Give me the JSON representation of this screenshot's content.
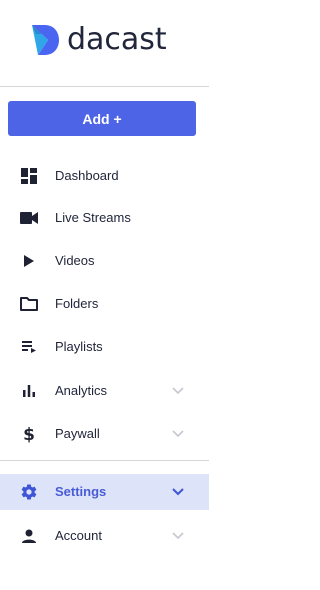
{
  "brand": {
    "name": "dacast",
    "accent": "#4d64e6",
    "logo_color": "#4a65f0"
  },
  "add_button": {
    "label": "Add +"
  },
  "nav": {
    "items": [
      {
        "label": "Dashboard",
        "icon": "dashboard-icon"
      },
      {
        "label": "Live Streams",
        "icon": "videocam-icon"
      },
      {
        "label": "Videos",
        "icon": "play-icon"
      },
      {
        "label": "Folders",
        "icon": "folder-icon"
      },
      {
        "label": "Playlists",
        "icon": "playlist-icon"
      },
      {
        "label": "Analytics",
        "icon": "bar-chart-icon",
        "expandable": true
      },
      {
        "label": "Paywall",
        "icon": "dollar-icon",
        "expandable": true
      },
      {
        "label": "Settings",
        "icon": "gear-icon",
        "expandable": true,
        "active": true
      },
      {
        "label": "Account",
        "icon": "person-icon",
        "expandable": true
      }
    ]
  },
  "colors": {
    "active_bg": "#dde3f8",
    "active_text": "#4a5cd6",
    "text": "#21263b",
    "chevron": "#c5c8d0",
    "divider": "#d6d6d6"
  }
}
